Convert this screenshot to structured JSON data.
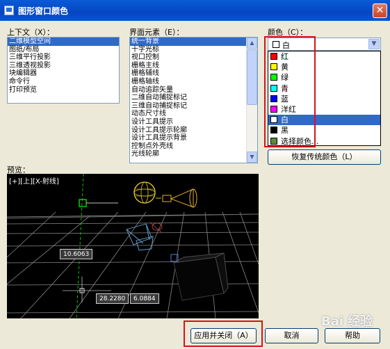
{
  "window": {
    "title": "图形窗口颜色",
    "close_glyph": "✕"
  },
  "context": {
    "label": "上下文（X）：",
    "items": [
      "二维模型空间",
      "图纸/布局",
      "三维平行投影",
      "三维透视投影",
      "块编辑器",
      "命令行",
      "打印预览"
    ],
    "selected_index": 0
  },
  "interface": {
    "label": "界面元素（E）：",
    "items": [
      "统一背景",
      "十字光标",
      "视口控制",
      "栅格主线",
      "栅格辅线",
      "栅格轴线",
      "自动追踪矢量",
      "二维自动捕捉标记",
      "三维自动捕捉标记",
      "动态尺寸线",
      "设计工具提示",
      "设计工具提示轮廓",
      "设计工具提示背景",
      "控制点外壳线",
      "光线轮廓"
    ],
    "selected_index": 0
  },
  "color": {
    "label": "颜色（C）：",
    "current_value": "白",
    "current_swatch": "#ffffff",
    "dropdown_arrow": "▼",
    "options": [
      {
        "label": "红",
        "swatch": "#ff0000"
      },
      {
        "label": "黄",
        "swatch": "#ffff00"
      },
      {
        "label": "绿",
        "swatch": "#00ff00"
      },
      {
        "label": "青",
        "swatch": "#00ffff"
      },
      {
        "label": "蓝",
        "swatch": "#0000ff"
      },
      {
        "label": "洋红",
        "swatch": "#ff00ff"
      },
      {
        "label": "白",
        "swatch": "#ffffff"
      },
      {
        "label": "黑",
        "swatch": "#000000"
      },
      {
        "label": "选择颜色...",
        "swatch": "#5a8a3a"
      }
    ],
    "selected_index": 6
  },
  "buttons": {
    "restore": "恢复传统颜色（L）",
    "apply_close": "应用并关闭（A）",
    "cancel": "取消",
    "help": "帮助"
  },
  "preview": {
    "label": "预览：",
    "viewport_caption": "[+][上][X-射线]",
    "dimensions": [
      "10.6063",
      "28.2280",
      "6.0884"
    ]
  },
  "watermark": "Bai 经验"
}
